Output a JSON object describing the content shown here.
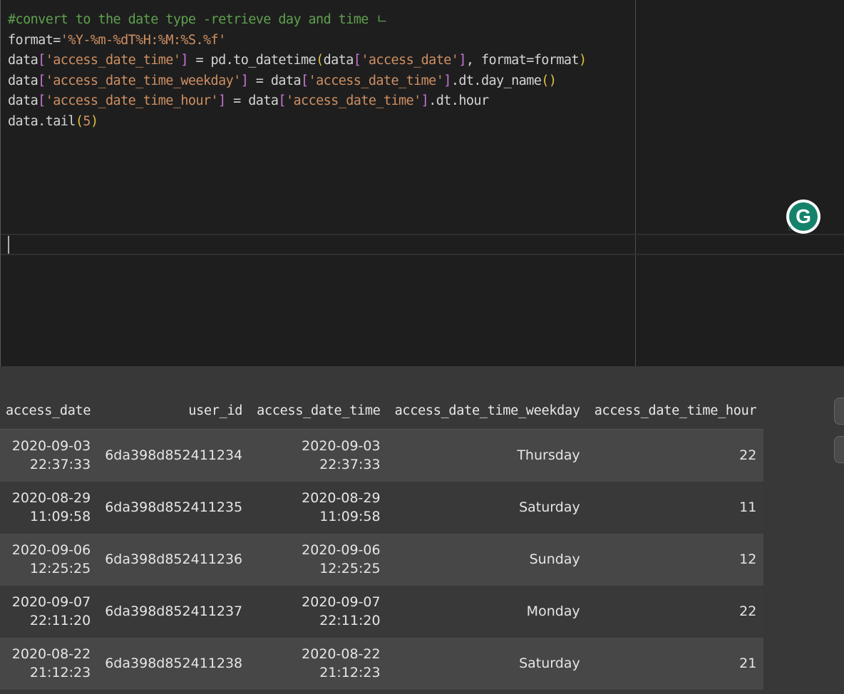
{
  "code": {
    "line1": "#convert to the date type -retrieve day and time ㄴ",
    "line2_var": "format=",
    "line2_str": "'%Y-%m-%dT%H:%M:%S.%f'",
    "line3_a": "data",
    "line3_key": "'access_date_time'",
    "line3_b": " = pd.to_datetime",
    "line3_arg_var": "data",
    "line3_arg_key": "'access_date'",
    "line3_c": ", format=format",
    "line4_a": "data",
    "line4_key": "'access_date_time_weekday'",
    "line4_b": " = data",
    "line4_key2": "'access_date_time'",
    "line4_c": ".dt.day_name",
    "line5_a": "data",
    "line5_key": "'access_date_time_hour'",
    "line5_b": " = data",
    "line5_key2": "'access_date_time'",
    "line5_c": ".dt.hour",
    "line6_a": "data.tail",
    "line6_arg": "5"
  },
  "grammarly": {
    "letter": "G"
  },
  "table": {
    "headers": [
      "access_date",
      "user_id",
      "access_date_time",
      "access_date_time_weekday",
      "access_date_time_hour"
    ],
    "rows": [
      {
        "access_date": [
          "2020-09-03",
          "22:37:33"
        ],
        "user_id": "6da398d852411234",
        "access_date_time": [
          "2020-09-03",
          "22:37:33"
        ],
        "weekday": "Thursday",
        "hour": "22"
      },
      {
        "access_date": [
          "2020-08-29",
          "11:09:58"
        ],
        "user_id": "6da398d852411235",
        "access_date_time": [
          "2020-08-29",
          "11:09:58"
        ],
        "weekday": "Saturday",
        "hour": "11"
      },
      {
        "access_date": [
          "2020-09-06",
          "12:25:25"
        ],
        "user_id": "6da398d852411236",
        "access_date_time": [
          "2020-09-06",
          "12:25:25"
        ],
        "weekday": "Sunday",
        "hour": "12"
      },
      {
        "access_date": [
          "2020-09-07",
          "22:11:20"
        ],
        "user_id": "6da398d852411237",
        "access_date_time": [
          "2020-09-07",
          "22:11:20"
        ],
        "weekday": "Monday",
        "hour": "22"
      },
      {
        "access_date": [
          "2020-08-22",
          "21:12:23"
        ],
        "user_id": "6da398d852411238",
        "access_date_time": [
          "2020-08-22",
          "21:12:23"
        ],
        "weekday": "Saturday",
        "hour": "21"
      }
    ]
  }
}
